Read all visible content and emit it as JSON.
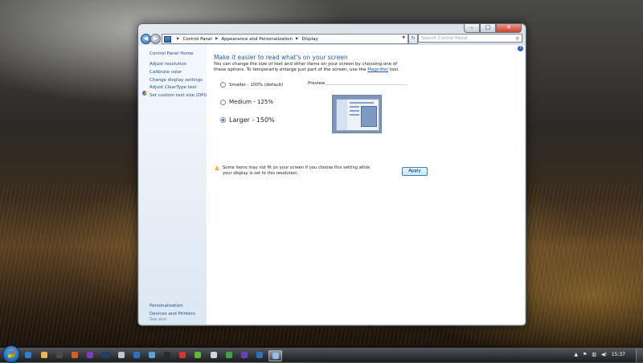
{
  "window": {
    "breadcrumb": [
      "Control Panel",
      "Appearance and Personalization",
      "Display"
    ],
    "search_placeholder": "Search Control Panel"
  },
  "sidebar": {
    "home": "Control Panel Home",
    "items": [
      "Adjust resolution",
      "Calibrate color",
      "Change display settings",
      "Adjust ClearType text",
      "Set custom text size (DPI)"
    ],
    "see_also_label": "See also",
    "see_also": [
      "Personalization",
      "Devices and Printers"
    ]
  },
  "main": {
    "heading": "Make it easier to read what's on your screen",
    "desc_1": "You can change the size of text and other items on your screen by choosing one of these options. To temporarily enlarge just part of the screen, use the ",
    "magnifier_link": "Magnifier",
    "desc_2": " tool.",
    "options": [
      {
        "label": "Smaller - 100% (default)",
        "selected": false
      },
      {
        "label": "Medium - 125%",
        "selected": false
      },
      {
        "label": "Larger - 150%",
        "selected": true
      }
    ],
    "preview_label": "Preview",
    "warning": "Some items may not fit on your screen if you choose this setting while your display is set to this resolution.",
    "apply_label": "Apply"
  },
  "taskbar": {
    "clock": "15:37",
    "pinned_colors": [
      "#2b7fd4",
      "#e8b64c",
      "#4a4a4a",
      "#e05a1b",
      "#7a3fb8",
      "#1e3f72",
      "#c0c6ce",
      "#2d6ec0",
      "#5aa0d8",
      "#2a2a2a",
      "#d8342a",
      "#5fb83a",
      "#cfd6de",
      "#3da34b",
      "#6a3fb0",
      "#2e6fc4",
      "#8fbfe8"
    ]
  },
  "colors": {
    "link": "#1d4f91",
    "heading": "#1e5dac",
    "accent": "#2a6ad1"
  }
}
